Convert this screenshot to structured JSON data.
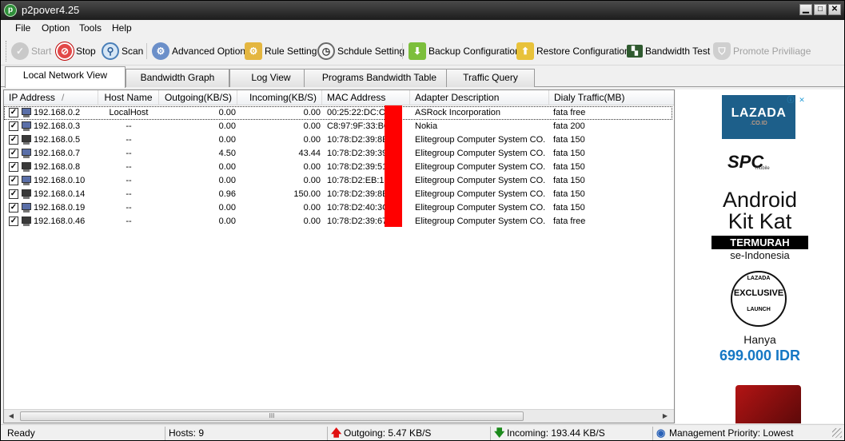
{
  "window": {
    "title": "p2pover4.25"
  },
  "menu": [
    "File",
    "Option",
    "Tools",
    "Help"
  ],
  "toolbar": {
    "start": "Start",
    "stop": "Stop",
    "scan": "Scan",
    "advanced": "Advanced Option",
    "rule": "Rule Setting",
    "schedule": "Schdule Setting",
    "backup": "Backup Configuration",
    "restore": "Restore Configuration",
    "bandwidth_test": "Bandwidth Test",
    "promote": "Promote Priviliage"
  },
  "tabs": [
    "Local Network View",
    "Bandwidth Graph",
    "Log View",
    "Programs Bandwidth Table",
    "Traffic Query"
  ],
  "columns": {
    "ip": "IP Address",
    "sort_indicator": "/",
    "host": "Host Name",
    "out": "Outgoing(KB/S)",
    "in": "Incoming(KB/S)",
    "mac": "MAC Address",
    "adapter": "Adapter Description",
    "traffic": "Dialy Traffic(MB)"
  },
  "rows": [
    {
      "ip": "192.168.0.2",
      "host": "LocalHost",
      "out": "0.00",
      "in": "0.00",
      "mac": "00:25:22:DC:CE",
      "adapter": "ASRock Incorporation",
      "traffic": "fata free"
    },
    {
      "ip": "192.168.0.3",
      "host": "--",
      "out": "0.00",
      "in": "0.00",
      "mac": "C8:97:9F:33:BO",
      "adapter": "Nokia",
      "traffic": "fata 200"
    },
    {
      "ip": "192.168.0.5",
      "host": "--",
      "out": "0.00",
      "in": "0.00",
      "mac": "10:78:D2:39:8E",
      "adapter": "Elitegroup Computer System CO.",
      "traffic": "fata 150"
    },
    {
      "ip": "192.168.0.7",
      "host": "--",
      "out": "4.50",
      "in": "43.44",
      "mac": "10:78:D2:39:39",
      "adapter": "Elitegroup Computer System CO.",
      "traffic": "fata 150"
    },
    {
      "ip": "192.168.0.8",
      "host": "--",
      "out": "0.00",
      "in": "0.00",
      "mac": "10:78:D2:39:51",
      "adapter": "Elitegroup Computer System CO.",
      "traffic": "fata 150"
    },
    {
      "ip": "192.168.0.10",
      "host": "--",
      "out": "0.00",
      "in": "0.00",
      "mac": "10:78:D2:EB:1E",
      "adapter": "Elitegroup Computer System CO.",
      "traffic": "fata 150"
    },
    {
      "ip": "192.168.0.14",
      "host": "--",
      "out": "0.96",
      "in": "150.00",
      "mac": "10:78:D2:39:8E",
      "adapter": "Elitegroup Computer System CO.",
      "traffic": "fata 150"
    },
    {
      "ip": "192.168.0.19",
      "host": "--",
      "out": "0.00",
      "in": "0.00",
      "mac": "10:78:D2:40:3C",
      "adapter": "Elitegroup Computer System CO.",
      "traffic": "fata 150"
    },
    {
      "ip": "192.168.0.46",
      "host": "--",
      "out": "0.00",
      "in": "0.00",
      "mac": "10:78:D2:39:67",
      "adapter": "Elitegroup Computer System CO.",
      "traffic": "fata free"
    }
  ],
  "scrollbar": {
    "grip": "III"
  },
  "ad": {
    "brand": "LAZADA",
    "brand_tld": ".CO.ID",
    "spc": "SPC",
    "spc_sub": "mobile",
    "headline1": "Android",
    "headline2": "Kit Kat",
    "termurah": "TERMURAH",
    "region": "se-Indonesia",
    "badge_top": "LAZADA",
    "badge_main": "EXCLUSIVE",
    "badge_bottom": "LAUNCH",
    "hanya": "Hanya",
    "price": "699.000 IDR"
  },
  "status": {
    "ready": "Ready",
    "hosts": "Hosts: 9",
    "outgoing": "Outgoing: 5.47 KB/S",
    "incoming": "Incoming: 193.44 KB/S",
    "priority": "Management Priority: Lowest"
  },
  "colors": {
    "redaction": "#ff0000",
    "ad_blue": "#1577c4",
    "lazada_bg": "#1d5f8a"
  }
}
